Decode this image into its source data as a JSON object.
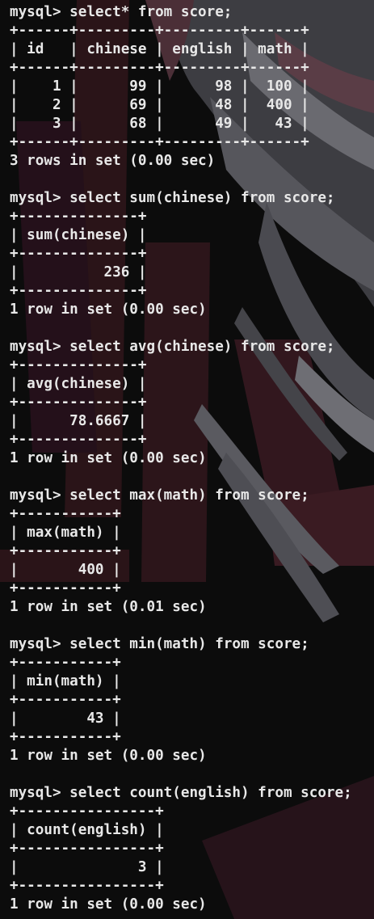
{
  "terminal": {
    "lines": [
      "mysql> select* from score;",
      "+------+---------+---------+------+",
      "| id   | chinese | english | math |",
      "+------+---------+---------+------+",
      "|    1 |      99 |      98 |  100 |",
      "|    2 |      69 |      48 |  400 |",
      "|    3 |      68 |      49 |   43 |",
      "+------+---------+---------+------+",
      "3 rows in set (0.00 sec)",
      "",
      "mysql> select sum(chinese) from score;",
      "+--------------+",
      "| sum(chinese) |",
      "+--------------+",
      "|          236 |",
      "+--------------+",
      "1 row in set (0.00 sec)",
      "",
      "mysql> select avg(chinese) from score;",
      "+--------------+",
      "| avg(chinese) |",
      "+--------------+",
      "|      78.6667 |",
      "+--------------+",
      "1 row in set (0.00 sec)",
      "",
      "mysql> select max(math) from score;",
      "+-----------+",
      "| max(math) |",
      "+-----------+",
      "|       400 |",
      "+-----------+",
      "1 row in set (0.01 sec)",
      "",
      "mysql> select min(math) from score;",
      "+-----------+",
      "| min(math) |",
      "+-----------+",
      "|        43 |",
      "+-----------+",
      "1 row in set (0.00 sec)",
      "",
      "mysql> select count(english) from score;",
      "+----------------+",
      "| count(english) |",
      "+----------------+",
      "|              3 |",
      "+----------------+",
      "1 row in set (0.00 sec)"
    ]
  }
}
